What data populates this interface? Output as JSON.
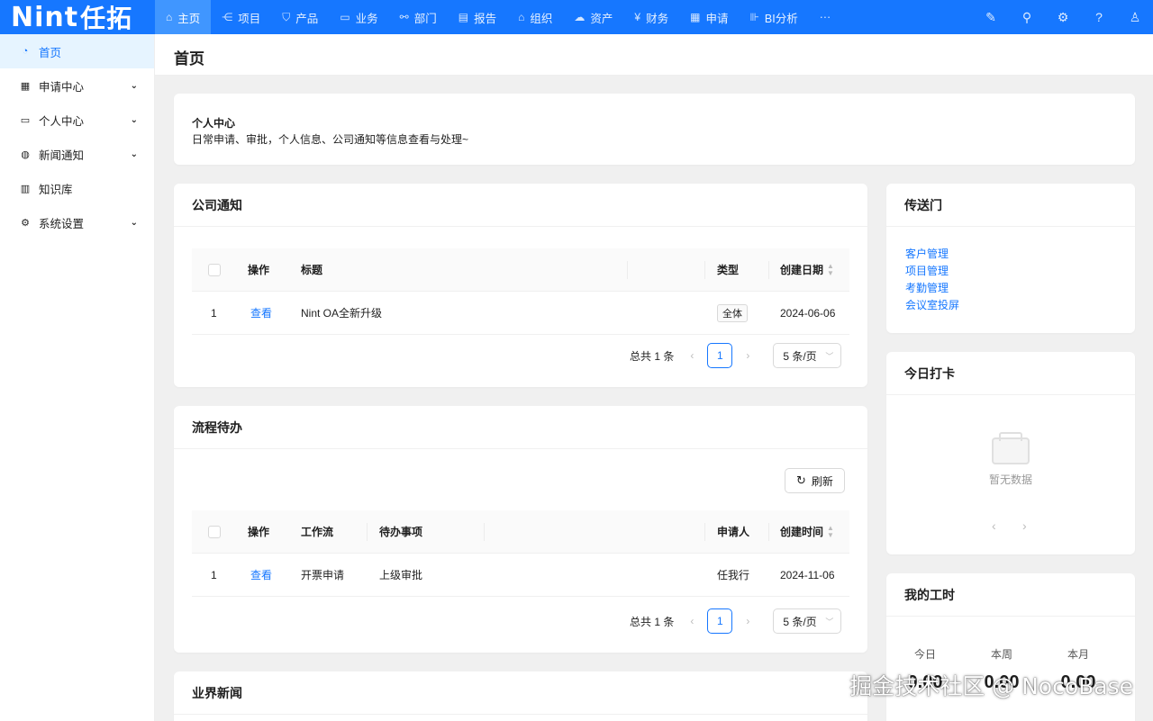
{
  "brand": {
    "logo_latin": "Nint",
    "logo_cn": "任拓"
  },
  "nav": [
    {
      "label": "主页",
      "icon": "home-icon",
      "glyph": "⌂"
    },
    {
      "label": "项目",
      "icon": "project-icon",
      "glyph": "⋲"
    },
    {
      "label": "产品",
      "icon": "product-icon",
      "glyph": "⛉"
    },
    {
      "label": "业务",
      "icon": "business-icon",
      "glyph": "▭"
    },
    {
      "label": "部门",
      "icon": "department-icon",
      "glyph": "⚯"
    },
    {
      "label": "报告",
      "icon": "report-icon",
      "glyph": "▤"
    },
    {
      "label": "组织",
      "icon": "organization-icon",
      "glyph": "⌂"
    },
    {
      "label": "资产",
      "icon": "assets-icon",
      "glyph": "☁"
    },
    {
      "label": "财务",
      "icon": "finance-icon",
      "glyph": "¥"
    },
    {
      "label": "申请",
      "icon": "apply-icon",
      "glyph": "▦"
    },
    {
      "label": "BI分析",
      "icon": "bi-chart-icon",
      "glyph": "⊪"
    },
    {
      "label": "···",
      "icon": "more-icon",
      "glyph": ""
    }
  ],
  "topright": [
    {
      "icon": "brush-icon",
      "glyph": "✎"
    },
    {
      "icon": "plugin-icon",
      "glyph": "⚲"
    },
    {
      "icon": "settings-icon",
      "glyph": "⚙"
    },
    {
      "icon": "help-icon",
      "glyph": "?"
    },
    {
      "icon": "user-icon",
      "glyph": "♙"
    }
  ],
  "sidebar": [
    {
      "label": "首页",
      "icon": "dashboard-icon",
      "glyph": "◔",
      "chevron": false
    },
    {
      "label": "申请中心",
      "icon": "apply-center-icon",
      "glyph": "▦",
      "chevron": true
    },
    {
      "label": "个人中心",
      "icon": "profile-card-icon",
      "glyph": "▭",
      "chevron": true
    },
    {
      "label": "新闻通知",
      "icon": "globe-icon",
      "glyph": "◍",
      "chevron": true
    },
    {
      "label": "知识库",
      "icon": "book-icon",
      "glyph": "▥",
      "chevron": false
    },
    {
      "label": "系统设置",
      "icon": "gear-icon",
      "glyph": "⚙",
      "chevron": true
    }
  ],
  "page": {
    "title": "首页"
  },
  "intro": {
    "title": "个人中心",
    "desc": "日常申请、审批，个人信息、公司通知等信息查看与处理~"
  },
  "notice": {
    "title": "公司通知",
    "headers": {
      "op": "操作",
      "title": "标题",
      "type": "类型",
      "date": "创建日期"
    },
    "rows": [
      {
        "no": "1",
        "op": "查看",
        "title": "Nint OA全新升级",
        "type": "全体",
        "date": "2024-06-06"
      }
    ],
    "pager": {
      "total": "总共 1 条",
      "page": "1",
      "size": "5 条/页"
    }
  },
  "todo": {
    "title": "流程待办",
    "refresh": "刷新",
    "headers": {
      "op": "操作",
      "flow": "工作流",
      "item": "待办事项",
      "applicant": "申请人",
      "time": "创建时间"
    },
    "rows": [
      {
        "no": "1",
        "op": "查看",
        "flow": "开票申请",
        "item": "上级审批",
        "applicant": "任我行",
        "time": "2024-11-06"
      }
    ],
    "pager": {
      "total": "总共 1 条",
      "page": "1",
      "size": "5 条/页"
    }
  },
  "news": {
    "title": "业界新闻"
  },
  "portal": {
    "title": "传送门",
    "links": [
      "客户管理",
      "项目管理",
      "考勤管理",
      "会议室投屏"
    ]
  },
  "checkin": {
    "title": "今日打卡",
    "empty": "暂无数据",
    "prev": "‹",
    "next": "›"
  },
  "hours": {
    "title": "我的工时",
    "stats": [
      {
        "label": "今日",
        "value": "0.00"
      },
      {
        "label": "本周",
        "value": "0.00"
      },
      {
        "label": "本月",
        "value": "0.00"
      }
    ]
  },
  "watermark": "掘金技术社区 @ NocoBase"
}
